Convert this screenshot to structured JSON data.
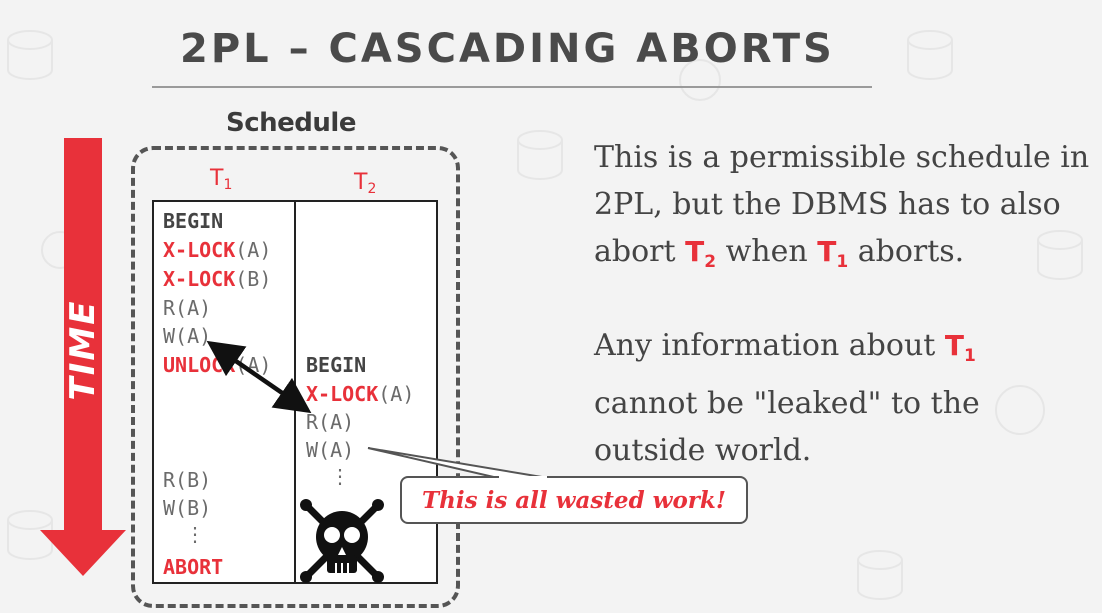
{
  "slide": {
    "title": "2PL – CASCADING ABORTS"
  },
  "time_axis": {
    "label": "TIME"
  },
  "schedule": {
    "label": "Schedule",
    "t1_header": {
      "name": "T",
      "sub": "1"
    },
    "t2_header": {
      "name": "T",
      "sub": "2"
    },
    "t1_ops": {
      "begin": "BEGIN",
      "xlock_a_kw": "X-LOCK",
      "xlock_a_arg": "(A)",
      "xlock_b_kw": "X-LOCK",
      "xlock_b_arg": "(B)",
      "read_a": "R(A)",
      "write_a": "W(A)",
      "unlock_kw": "UNLOCK",
      "unlock_arg": "(A)",
      "read_b": "R(B)",
      "write_b": "W(B)",
      "ellipsis": "⋮",
      "abort": "ABORT"
    },
    "t2_ops": {
      "begin": "BEGIN",
      "xlock_a_kw": "X-LOCK",
      "xlock_a_arg": "(A)",
      "read_a": "R(A)",
      "write_a": "W(A)",
      "ellipsis": "⋮"
    }
  },
  "callout": {
    "text": "This is all wasted work!"
  },
  "explanation": {
    "p1": {
      "line1": "This is a permissible schedule in",
      "line2": "2PL, but the DBMS has to also",
      "abort_word": "abort",
      "t2": "T",
      "t2_sub": "2",
      "when_word": "when",
      "t1": "T",
      "t1_sub": "1",
      "aborts_word": "aborts."
    },
    "p2": {
      "lead": "Any information about",
      "t1": "T",
      "t1_sub": "1",
      "line2": "cannot be \"leaked\" to the",
      "line3": "outside world."
    }
  },
  "colors": {
    "accent_red": "#e8313a",
    "title_gray": "#4a4a4a",
    "background": "#f3f3f3"
  },
  "icons": {
    "skull": "skull-crossbones-icon",
    "double_arrow": "double-headed-arrow-icon",
    "time_arrow": "down-arrow-icon"
  }
}
